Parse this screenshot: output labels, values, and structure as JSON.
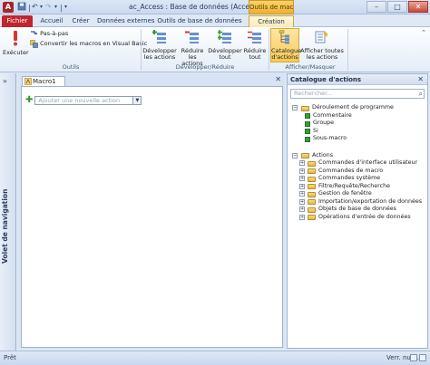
{
  "window": {
    "app_icon_letter": "A",
    "title": "ac_Access : Base de données (Access 20...",
    "context_tab_header": "Outils de macro",
    "qat_icons": [
      "save-icon",
      "undo-icon",
      "redo-icon",
      "customize-qat-icon"
    ],
    "controls": {
      "minimize": "–",
      "maximize": "□",
      "close": "✕"
    }
  },
  "tabs": [
    {
      "label": "Fichier"
    },
    {
      "label": "Accueil"
    },
    {
      "label": "Créer"
    },
    {
      "label": "Données externes"
    },
    {
      "label": "Outils de base de données"
    },
    {
      "label": "Création"
    }
  ],
  "ribbon": {
    "outils": {
      "label": "Outils",
      "executer": "Exécuter",
      "pas_a_pas": "Pas-à-pas",
      "convertir": "Convertir les macros en Visual Basic"
    },
    "developper_reduire": {
      "label": "Développer/Réduire",
      "developper_actions": [
        "Développer",
        "les actions"
      ],
      "reduire_actions": [
        "Réduire",
        "les actions"
      ],
      "developper_tout": [
        "Développer",
        "tout"
      ],
      "reduire_tout": [
        "Réduire",
        "tout"
      ]
    },
    "afficher_masquer": {
      "label": "Afficher/Masquer",
      "catalogue": [
        "Catalogue",
        "d'actions"
      ],
      "afficher_toutes": [
        "Afficher toutes",
        "les actions"
      ]
    }
  },
  "nav_pane": {
    "toggle": "»",
    "label": "Volet de navigation"
  },
  "document": {
    "tab_label": "Macro1",
    "close": "✕",
    "add_action_placeholder": "Ajouter une nouvelle action"
  },
  "catalogue": {
    "title": "Catalogue d'actions",
    "close": "✕",
    "search_placeholder": "Rechercher...",
    "program_flow": {
      "label": "Déroulement de programme",
      "items": [
        "Commentaire",
        "Groupe",
        "Si",
        "Sous-macro"
      ]
    },
    "actions": {
      "label": "Actions",
      "items": [
        "Commandes d'interface utilisateur",
        "Commandes de macro",
        "Commandes système",
        "Filtre/Requête/Recherche",
        "Gestion de fenêtre",
        "Importation/exportation de données",
        "Objets de base de données",
        "Opérations d'entrée de données"
      ]
    }
  },
  "statusbar": {
    "left": "Prêt",
    "right": "Verr. num."
  },
  "colors": {
    "file_tab": "#c0252d",
    "context_tab": "#ebb033",
    "highlight": "#f8c955",
    "add_icon": "#2e9a2e"
  }
}
